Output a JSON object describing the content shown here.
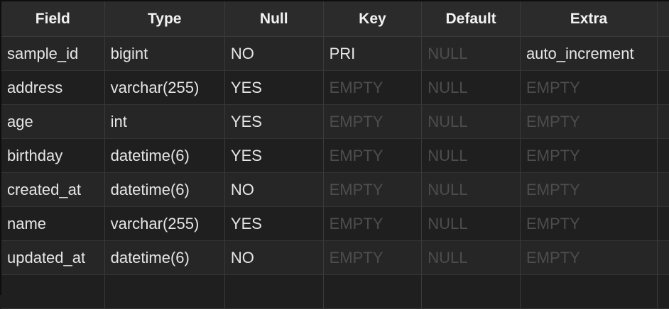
{
  "columns": [
    "Field",
    "Type",
    "Null",
    "Key",
    "Default",
    "Extra"
  ],
  "rows": [
    {
      "field": "sample_id",
      "type": "bigint",
      "null": "NO",
      "key": "PRI",
      "default": "NULL",
      "extra": "auto_increment"
    },
    {
      "field": "address",
      "type": "varchar(255)",
      "null": "YES",
      "key": "EMPTY",
      "default": "NULL",
      "extra": "EMPTY"
    },
    {
      "field": "age",
      "type": "int",
      "null": "YES",
      "key": "EMPTY",
      "default": "NULL",
      "extra": "EMPTY"
    },
    {
      "field": "birthday",
      "type": "datetime(6)",
      "null": "YES",
      "key": "EMPTY",
      "default": "NULL",
      "extra": "EMPTY"
    },
    {
      "field": "created_at",
      "type": "datetime(6)",
      "null": "NO",
      "key": "EMPTY",
      "default": "NULL",
      "extra": "EMPTY"
    },
    {
      "field": "name",
      "type": "varchar(255)",
      "null": "YES",
      "key": "EMPTY",
      "default": "NULL",
      "extra": "EMPTY"
    },
    {
      "field": "updated_at",
      "type": "datetime(6)",
      "null": "NO",
      "key": "EMPTY",
      "default": "NULL",
      "extra": "EMPTY"
    }
  ],
  "placeholders": [
    "NULL",
    "EMPTY"
  ],
  "colors": {
    "background": "#1f1f1f",
    "header_background": "#2b2b2b",
    "text": "#e6e6e6",
    "placeholder_text": "#4d4d4d"
  }
}
